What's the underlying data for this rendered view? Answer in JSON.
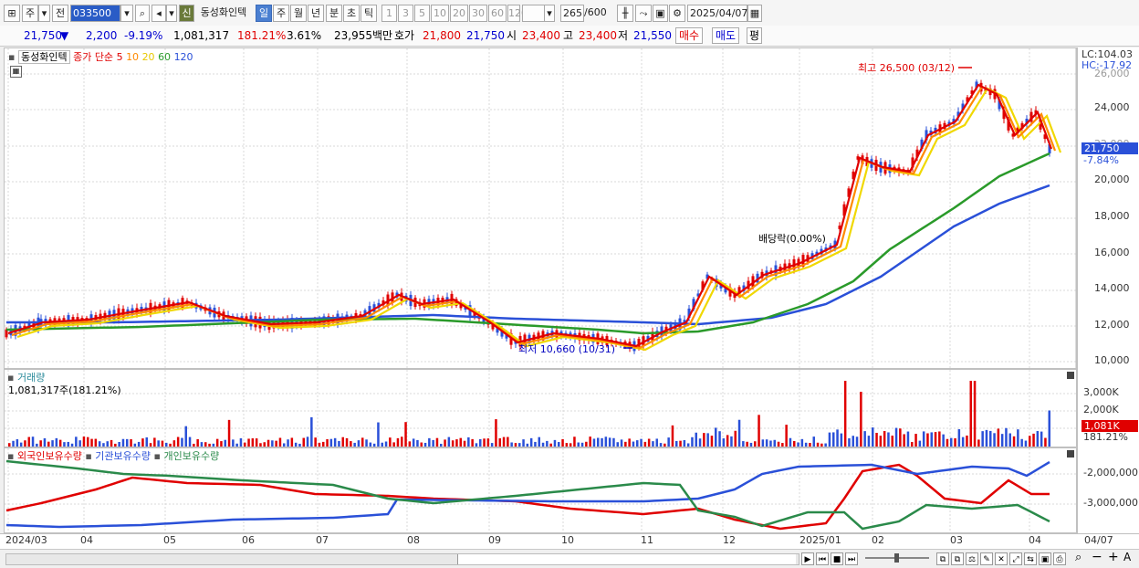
{
  "toolbar": {
    "market": "주",
    "prev_label": "전",
    "code": "033500",
    "stock_badge": "신",
    "stock_name": "동성화인텍",
    "periods": [
      "일",
      "주",
      "월",
      "년",
      "분",
      "초",
      "틱"
    ],
    "intervals": [
      "1",
      "3",
      "5",
      "10",
      "20",
      "30",
      "60",
      "120"
    ],
    "count": "265",
    "count_total": "/600",
    "date": "2025/04/07"
  },
  "infobar": {
    "price": "21,750",
    "down_arrow": "▼",
    "change": "2,200",
    "change_pct": "-9.19%",
    "volume": "1,081,317",
    "vol_ratio": "181.21%",
    "turnover": "3.61%",
    "amount": "23,955백만",
    "bid_label": "호가",
    "bid1": "21,800",
    "bid2": "21,750",
    "open_label": "시",
    "open": "23,400",
    "high_label": "고",
    "high": "23,400",
    "low_label": "저",
    "low": "21,550",
    "buy_label": "매수",
    "sell_label": "매도",
    "flat_label": "평"
  },
  "price_panel": {
    "name": "동성화인텍",
    "legend_prefix": "종가 단순",
    "ma_periods": [
      "5",
      "10",
      "20",
      "60",
      "120"
    ],
    "ma_colors": [
      "#e00000",
      "#ff8a00",
      "#f0d800",
      "#2a9a2a",
      "#2a50d8"
    ],
    "high_annotation": "최고 26,500 (03/12)",
    "low_annotation": "최저 10,660 (10/31)",
    "dividend_annotation": "배당락(0.00%)",
    "lc_label": "LC:104.03",
    "hc_label": "HC:-17.92",
    "current_price": "21,750",
    "current_pct": "-7.84%",
    "y_ticks": [
      "24,000",
      "22,000",
      "20,000",
      "18,000",
      "16,000",
      "14,000",
      "12,000",
      "10,000"
    ],
    "y_top_tick": "26,000"
  },
  "volume_panel": {
    "title": "거래량",
    "value_line": "1,081,317주(181.21%)",
    "y_ticks": [
      "3,000K",
      "2,000K",
      "1,000K"
    ],
    "current": "1,081K",
    "current_pct": "181.21%"
  },
  "holders_panel": {
    "series": [
      "외국인보유수량",
      "기관보유수량",
      "개인보유수량"
    ],
    "series_colors": [
      "#e00000",
      "#2a50d8",
      "#2a8a4a"
    ],
    "y_ticks": [
      "-2,000,000",
      "-3,000,000"
    ]
  },
  "x_axis": {
    "labels": [
      "2024/03",
      "04",
      "05",
      "06",
      "07",
      "08",
      "09",
      "10",
      "11",
      "12",
      "2025/01",
      "02",
      "03",
      "04",
      "04/07"
    ]
  }
}
